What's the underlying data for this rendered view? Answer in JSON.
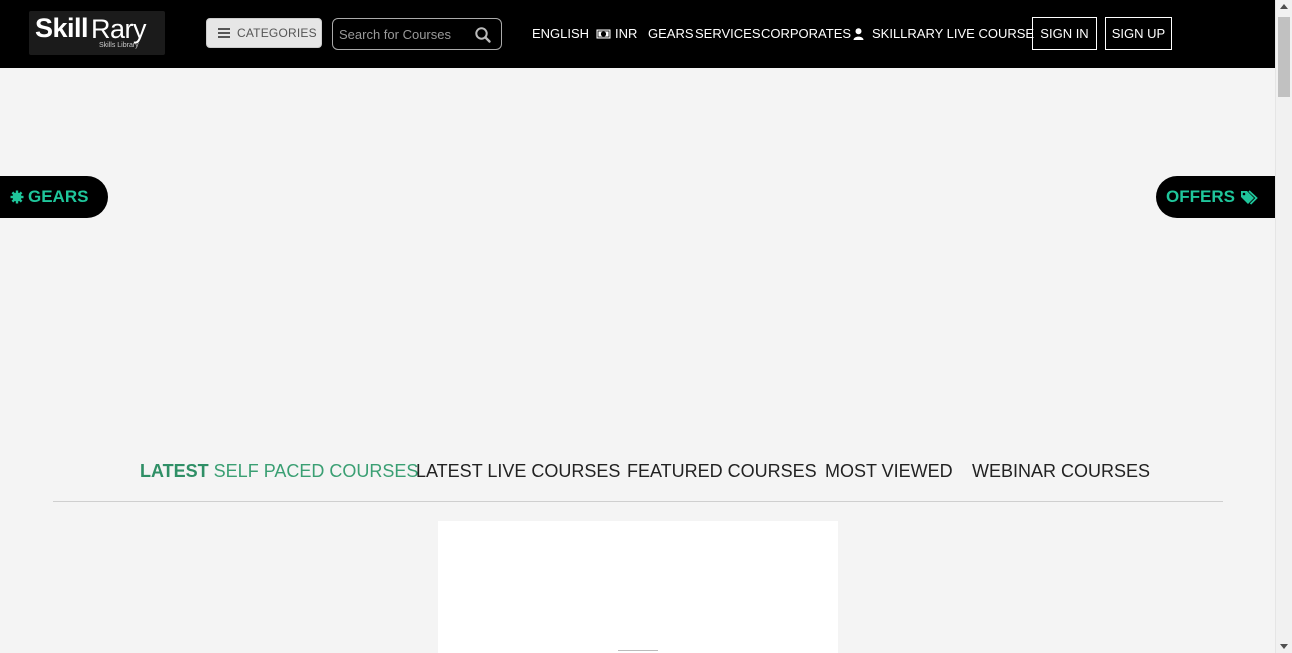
{
  "brand": {
    "name_part1": "Skill",
    "name_part2": "Rary",
    "tagline": "Skills Library"
  },
  "header": {
    "categories_label": "CATEGORIES",
    "search": {
      "placeholder": "Search for Courses",
      "value": ""
    },
    "nav": {
      "language": "ENGLISH",
      "currency": "INR",
      "gears": "GEARS",
      "services": "SERVICES",
      "corporates": "CORPORATES",
      "live_course": "SKILLRARY LIVE  COURSE",
      "sign_in": "SIGN IN",
      "sign_up": "SIGN UP"
    }
  },
  "side_tabs": {
    "gears": "GEARS",
    "offers": "OFFERS"
  },
  "course_tabs": {
    "active_prefix": "LATEST",
    "active_rest": " SELF PACED COURSES",
    "items": [
      "LATEST LIVE COURSES",
      "FEATURED COURSES",
      "MOST VIEWED",
      "WEBINAR COURSES"
    ]
  },
  "colors": {
    "accent": "#1fc69b",
    "active_tab": "#3a9f73",
    "header_bg": "#000000",
    "page_bg": "#f4f4f4"
  },
  "icons": [
    "menu-icon",
    "search-icon",
    "money-icon",
    "user-icon",
    "gear-icon",
    "tag-icon"
  ]
}
